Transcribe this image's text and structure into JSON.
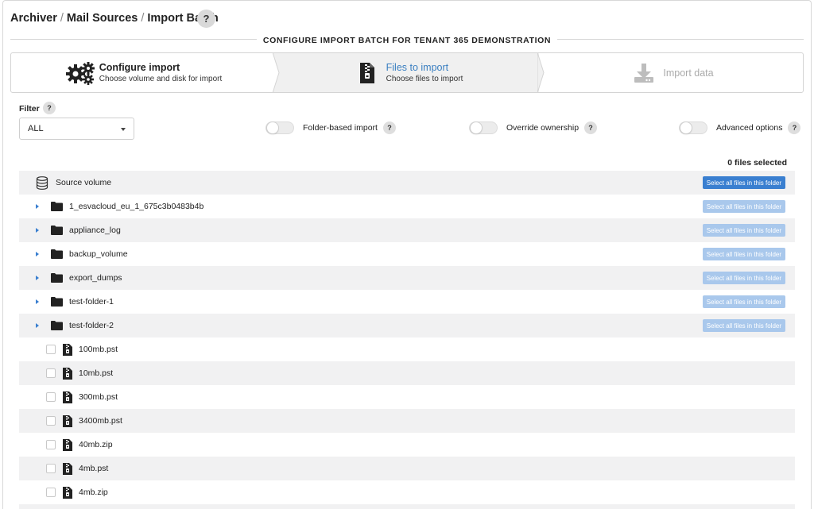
{
  "breadcrumb": {
    "archiver": "Archiver",
    "sep1": "/",
    "mail_sources": "Mail Sources",
    "sep2": "/",
    "import_batch": "Import Batch",
    "help": "?"
  },
  "page_title": "CONFIGURE IMPORT BATCH FOR TENANT 365 DEMONSTRATION",
  "wizard": {
    "steps": [
      {
        "title": "Configure import",
        "subtitle": "Choose volume and disk for import",
        "icon": "gears-icon",
        "state": "done"
      },
      {
        "title": "Files to import",
        "subtitle": "Choose files to import",
        "icon": "zip-file-icon",
        "state": "active"
      },
      {
        "title": "Import data",
        "subtitle": "",
        "icon": "download-icon",
        "state": "disabled"
      }
    ]
  },
  "filter": {
    "label": "Filter",
    "help": "?",
    "selected": "ALL"
  },
  "toggles": [
    {
      "label": "Folder-based import",
      "help": "?",
      "on": false
    },
    {
      "label": "Override ownership",
      "help": "?",
      "on": false
    },
    {
      "label": "Advanced options",
      "help": "?",
      "on": false
    }
  ],
  "files_selected": "0 files selected",
  "colors": {
    "accent": "#3a7fd0",
    "accent_light": "#a9c8ec",
    "row_alt": "#f1f1f2"
  },
  "tree": {
    "root": {
      "label": "Source volume",
      "button": "Select all files in this folder"
    },
    "folders": [
      {
        "name": "1_esvacloud_eu_1_675c3b0483b4b",
        "button": "Select all files in this folder"
      },
      {
        "name": "appliance_log",
        "button": "Select all files in this folder"
      },
      {
        "name": "backup_volume",
        "button": "Select all files in this folder"
      },
      {
        "name": "export_dumps",
        "button": "Select all files in this folder"
      },
      {
        "name": "test-folder-1",
        "button": "Select all files in this folder"
      },
      {
        "name": "test-folder-2",
        "button": "Select all files in this folder"
      }
    ],
    "files": [
      {
        "name": "100mb.pst"
      },
      {
        "name": "10mb.pst"
      },
      {
        "name": "300mb.pst"
      },
      {
        "name": "3400mb.pst"
      },
      {
        "name": "40mb.zip"
      },
      {
        "name": "4mb.pst"
      },
      {
        "name": "4mb.zip"
      }
    ]
  }
}
